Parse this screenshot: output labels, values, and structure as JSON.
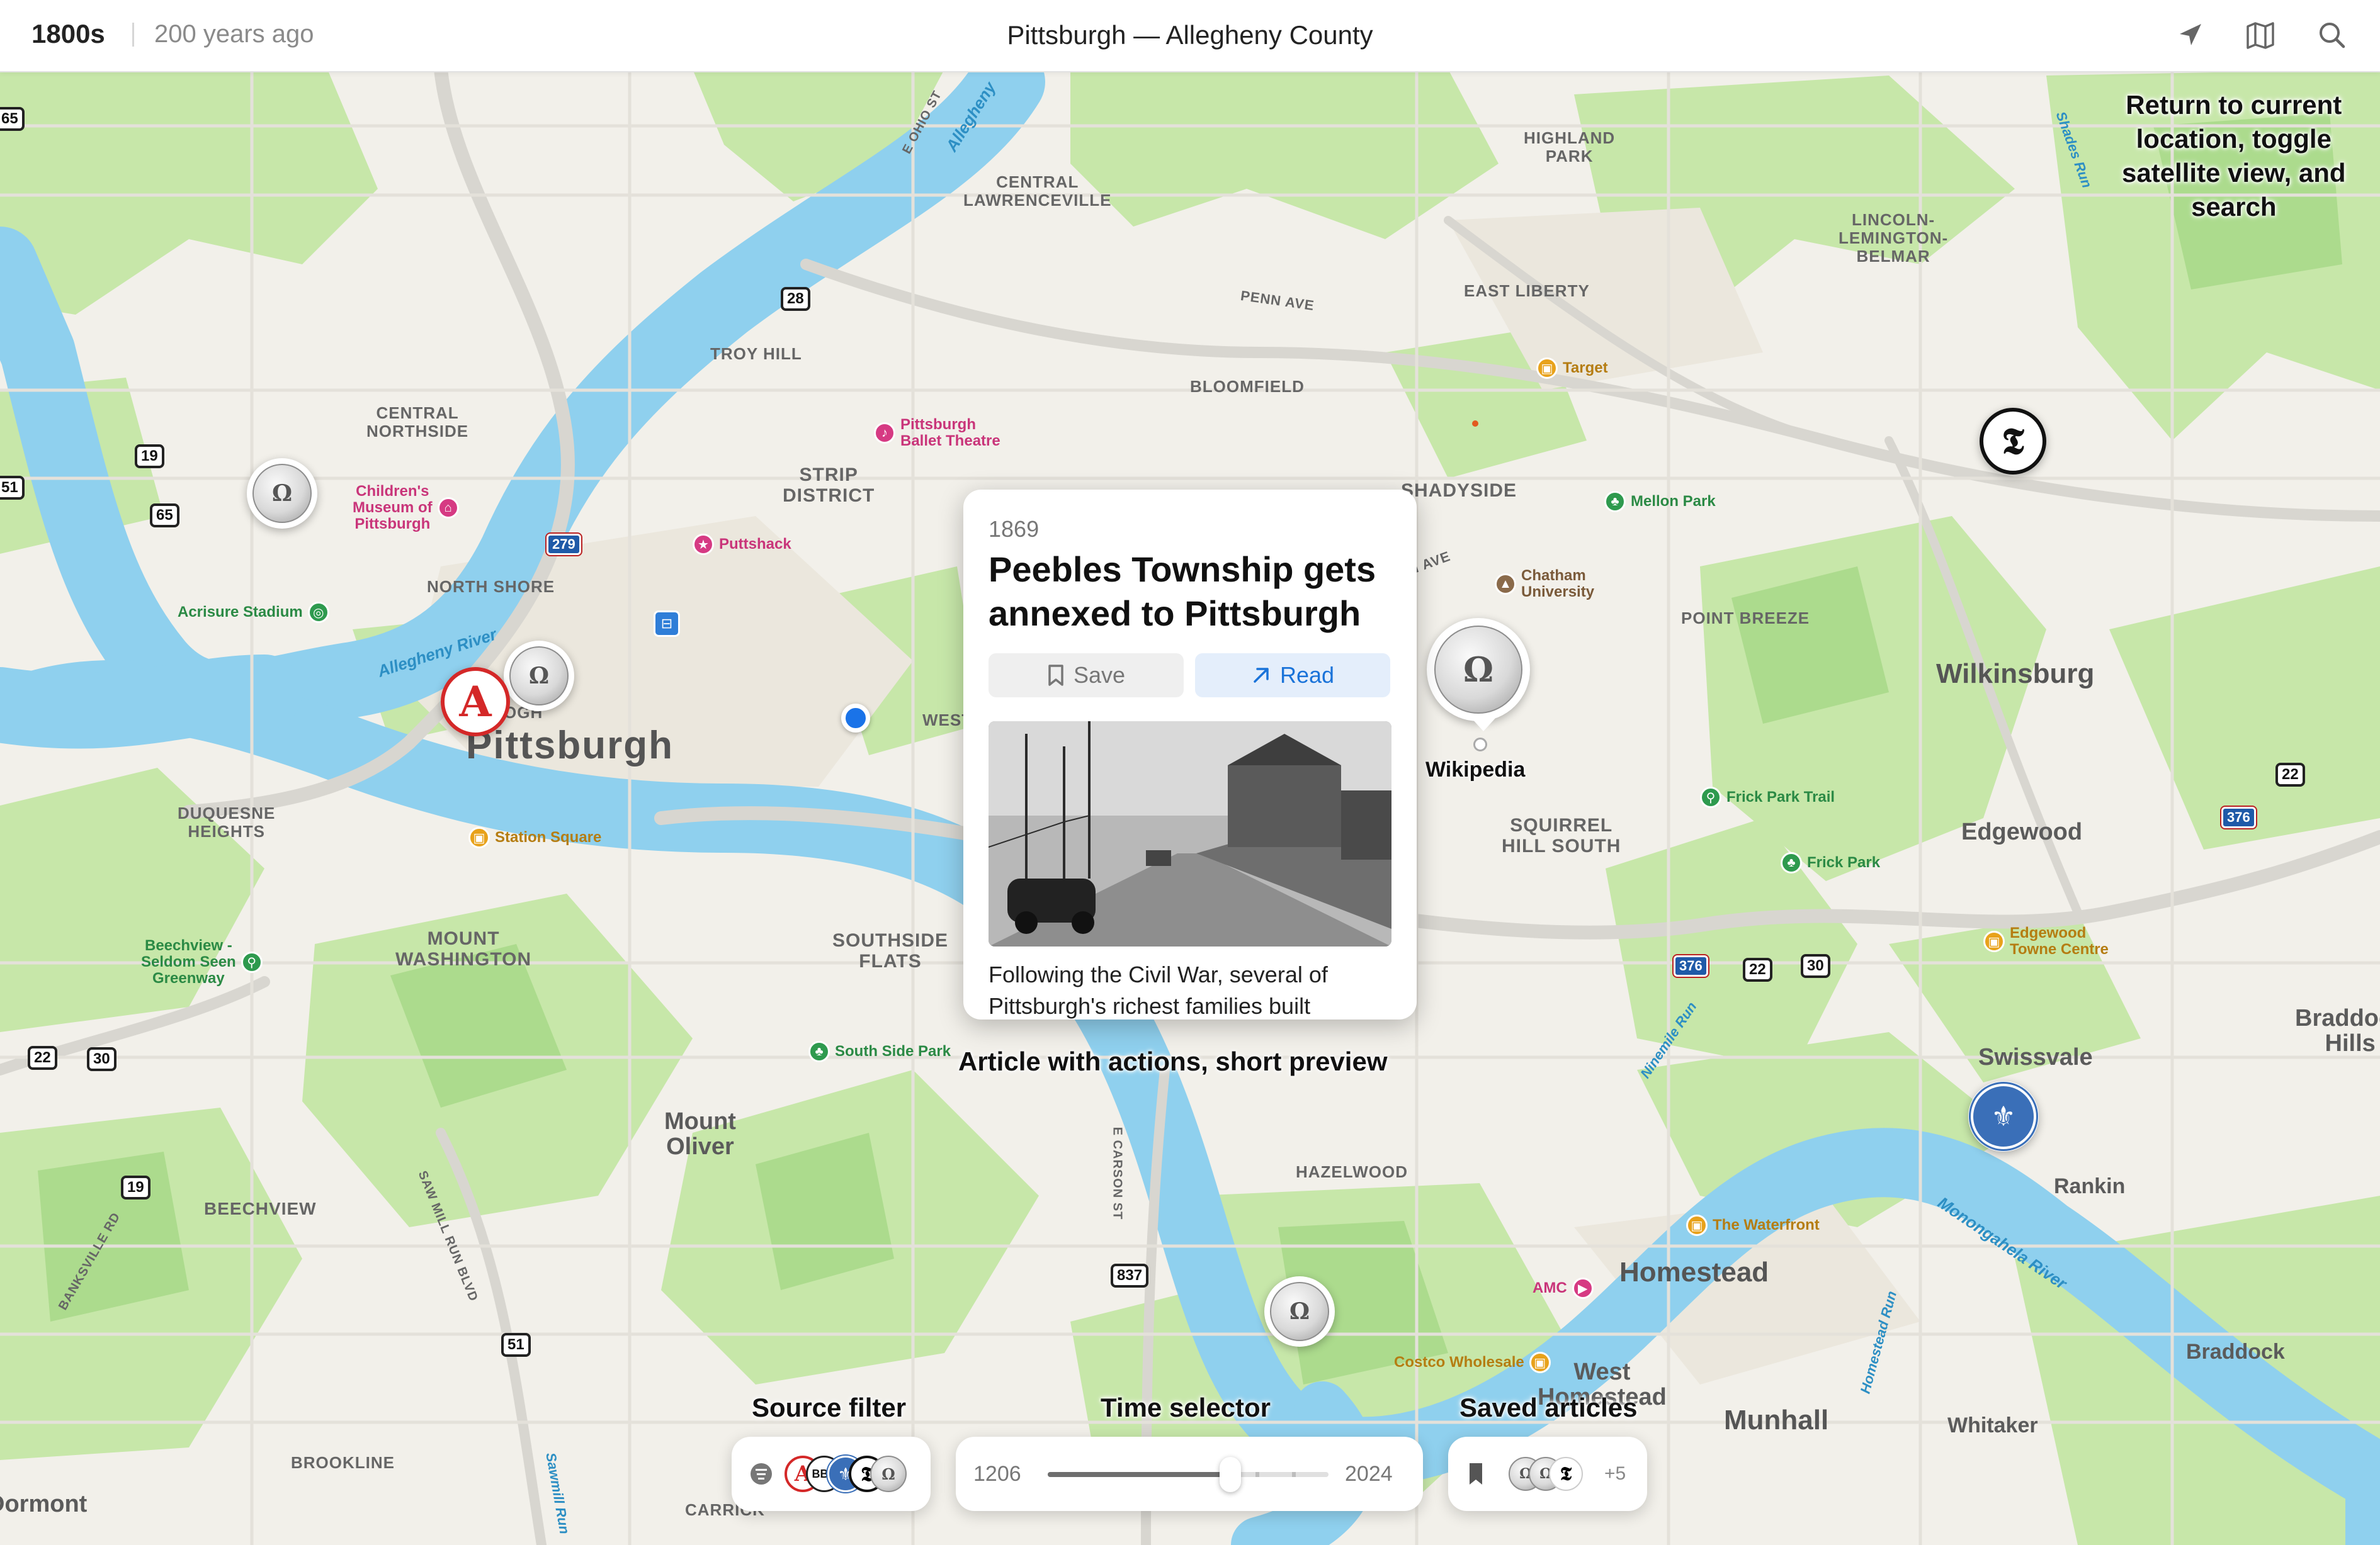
{
  "header": {
    "era": "1800s",
    "years_ago": "200 years ago",
    "place": "Pittsburgh — Allegheny County",
    "icons": [
      "location-arrow-icon",
      "map-icon",
      "search-icon"
    ]
  },
  "map": {
    "neighborhoods": {
      "central_lawrenceville": "CENTRAL\nLAWRENCEVILLE",
      "highland_park": "HIGHLAND\nPARK",
      "lincoln_lemington": "LINCOLN-\nLEMINGTON-\nBELMAR",
      "east_liberty": "EAST LIBERTY",
      "troy_hill": "TROY HILL",
      "bloomfield": "BLOOMFIELD",
      "central_northside": "CENTRAL\nNORTHSIDE",
      "strip_district": "STRIP\nDISTRICT",
      "shadyside": "SHADYSIDE",
      "north_shore": "NORTH SHORE",
      "point_breeze": "POINT BREEZE",
      "duquesne_heights": "DUQUESNE\nHEIGHTS",
      "squirrel_hill_south": "SQUIRREL\nHILL SOUTH",
      "mount_washington": "MOUNT\nWASHINGTON",
      "southside_flats": "SOUTHSIDE\nFLATS",
      "beechview": "BEECHVIEW",
      "hazelwood": "HAZELWOOD",
      "brookline": "BROOKLINE",
      "carrick": "CARRICK",
      "west": "WEST",
      "penn_ave": "PENN AVE",
      "ave": "H AVE",
      "e_carson_st": "E CARSON ST",
      "saw_mill_run_blvd": "SAW MILL RUN BLVD",
      "banksville_rd": "BANKSVILLE RD",
      "e_ohio_st": "E OHIO ST"
    },
    "towns": {
      "pittsburgh": "Pittsburgh",
      "wilkinsburg": "Wilkinsburg",
      "edgewood": "Edgewood",
      "swissvale": "Swissvale",
      "braddock_hills": "Braddock\nHills",
      "rankin": "Rankin",
      "homestead": "Homestead",
      "west_homestead": "West\nHomestead",
      "munhall": "Munhall",
      "whitaker": "Whitaker",
      "braddock": "Braddock",
      "mount_oliver": "Mount\nOliver",
      "dormont": "Dormont",
      "partial_ogh": "OGH"
    },
    "pois": [
      {
        "name": "Pittsburgh\nBallet Theatre",
        "color": "#d63a83",
        "icon": "theatre-icon"
      },
      {
        "name": "Target",
        "color": "#e8a21b",
        "icon": "shopping-bag-icon"
      },
      {
        "name": "Children's\nMuseum of\nPittsburgh",
        "color": "#d63a83",
        "icon": "museum-icon"
      },
      {
        "name": "Puttshack",
        "color": "#d63a83",
        "icon": "star-icon"
      },
      {
        "name": "Mellon Park",
        "color": "#2e9a4e",
        "icon": "tree-icon"
      },
      {
        "name": "Chatham\nUniversity",
        "color": "#8a6a4a",
        "icon": "school-icon"
      },
      {
        "name": "Acrisure Stadium",
        "color": "#2e9a4e",
        "icon": "stadium-icon"
      },
      {
        "name": "Station Square",
        "color": "#e8a21b",
        "icon": "shopping-bag-icon"
      },
      {
        "name": "Frick Park Trail",
        "color": "#2e9a4e",
        "icon": "hiker-icon"
      },
      {
        "name": "Frick Park",
        "color": "#2e9a4e",
        "icon": "tree-icon"
      },
      {
        "name": "Edgewood\nTowne Centre",
        "color": "#e8a21b",
        "icon": "shopping-bag-icon"
      },
      {
        "name": "Beechview -\nSeldom Seen\nGreenway",
        "color": "#2e9a4e",
        "icon": "hiker-icon"
      },
      {
        "name": "South Side Park",
        "color": "#2e9a4e",
        "icon": "tree-icon"
      },
      {
        "name": "The Waterfront",
        "color": "#e8a21b",
        "icon": "shopping-bag-icon"
      },
      {
        "name": "AMC",
        "color": "#d63a83",
        "icon": "film-icon"
      },
      {
        "name": "Costco Wholesale",
        "color": "#e8a21b",
        "icon": "shopping-bag-icon"
      }
    ],
    "rivers": [
      "Allegheny River",
      "Allegheny",
      "Monongahela River",
      "Ninemile Run",
      "Homestead Run",
      "Shades Run",
      "Sawmill Run"
    ],
    "routes": [
      "28",
      "19",
      "65",
      "51",
      "279",
      "22",
      "30",
      "376",
      "837",
      "65"
    ],
    "markers": {
      "wikipedia_label": "Wikipedia",
      "nyt_glyph": "𝕿",
      "ap_glyph": "A"
    }
  },
  "annotations": {
    "top_right": "Return to current\nlocation, toggle\nsatellite view, and\nsearch",
    "card": "Article with actions, short preview",
    "source_filter": "Source filter",
    "time_selector": "Time selector",
    "saved_articles": "Saved articles"
  },
  "card": {
    "year": "1869",
    "title": "Peebles Township gets annexed to Pittsburgh",
    "save_label": "Save",
    "read_label": "Read",
    "preview": "Following the Civil War, several of Pittsburgh's richest families built"
  },
  "time": {
    "start": "1206",
    "end": "2024",
    "position": 0.65
  },
  "saved": {
    "more": "+5"
  },
  "colors": {
    "water": "#8fd0ee",
    "park": "#c4e6a6",
    "land": "#f2f0ea",
    "accent": "#1a73d9",
    "ap_red": "#d42828",
    "user_dot": "#1a73e8"
  }
}
